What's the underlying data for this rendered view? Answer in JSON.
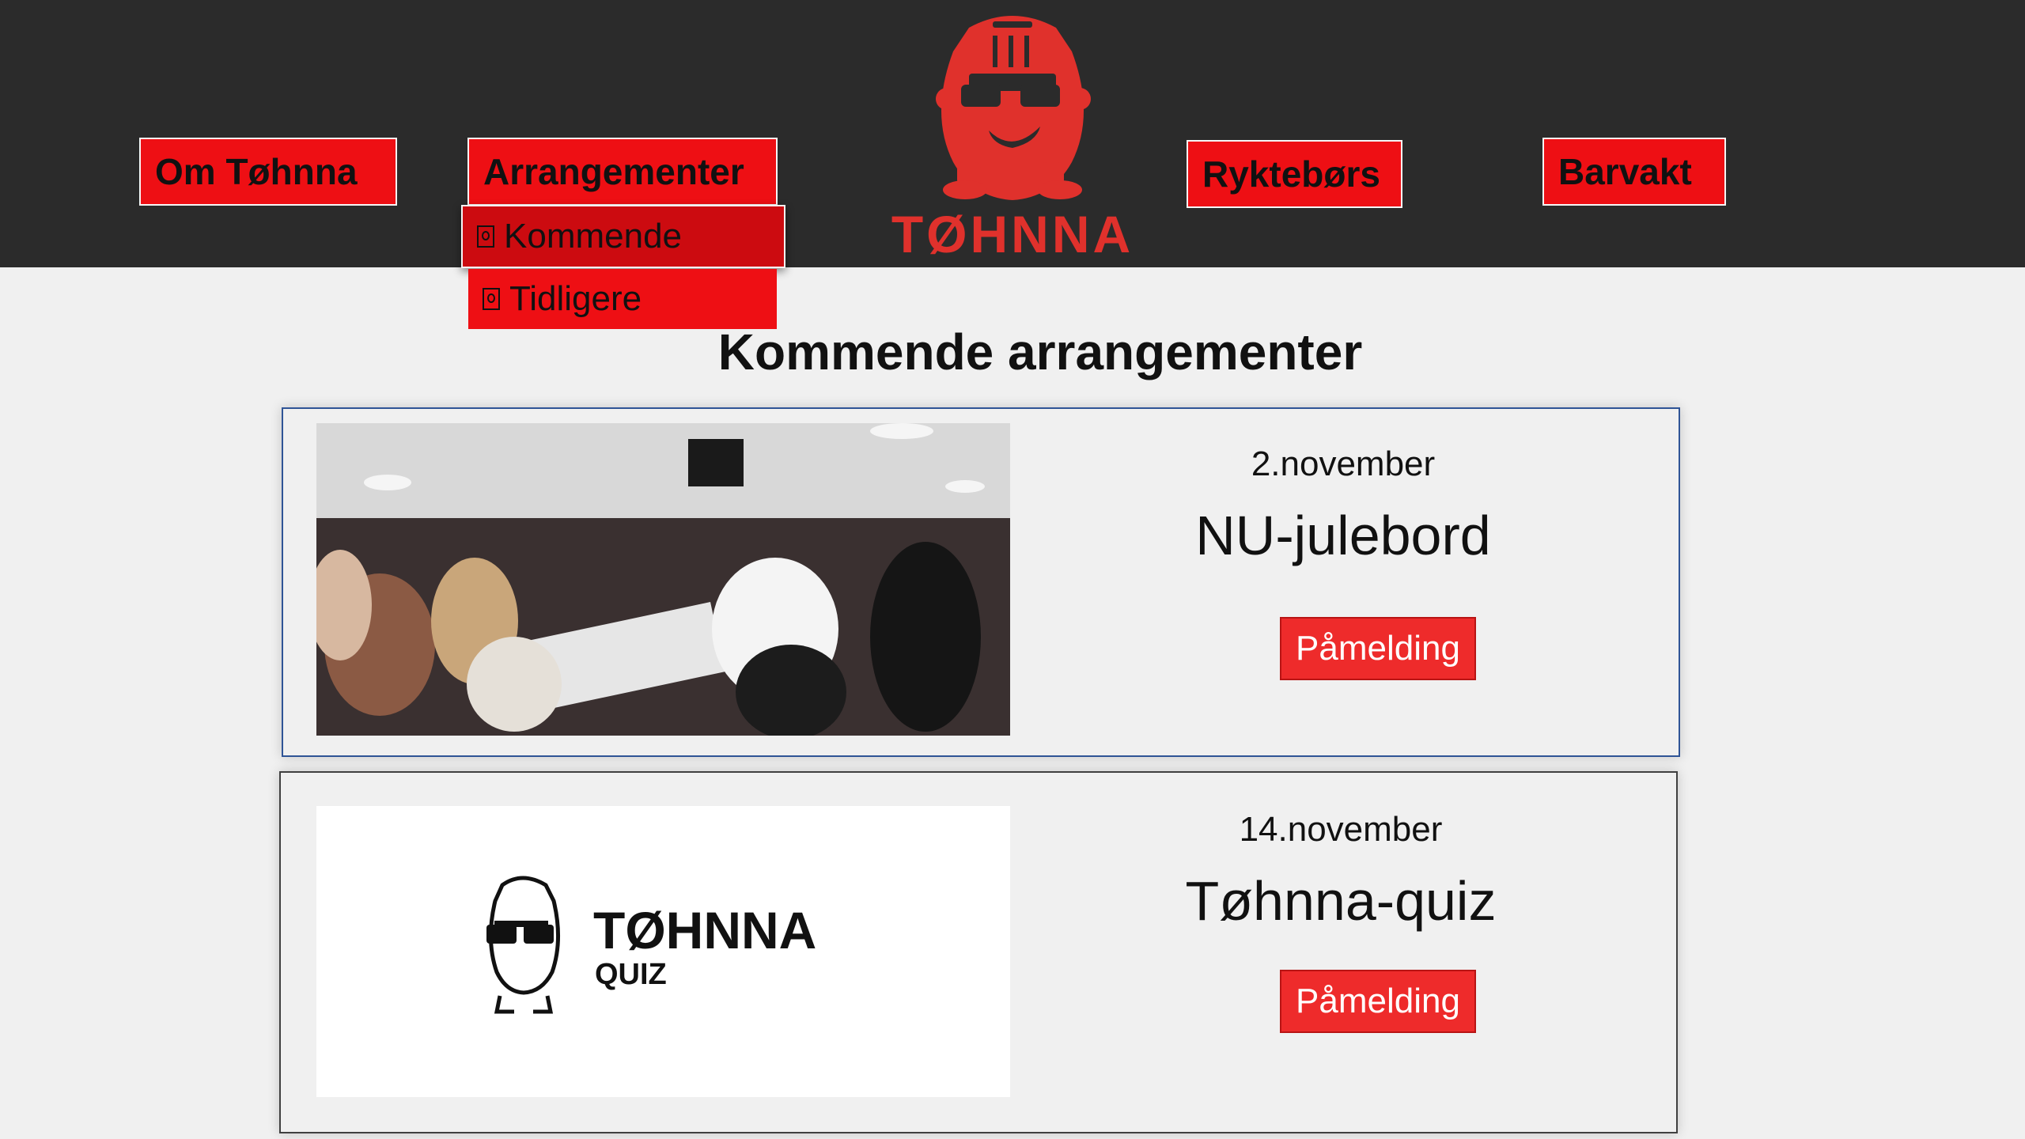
{
  "nav": {
    "about": "Om Tøhnna",
    "events": "Arrangementer",
    "rumors": "Ryktebørs",
    "bar": "Barvakt"
  },
  "dropdown": {
    "upcoming": "Kommende",
    "previous": "Tidligere"
  },
  "logo": {
    "text": "TØHNNA"
  },
  "page": {
    "heading": "Kommende arrangementer"
  },
  "events": [
    {
      "date": "2.november",
      "title": "NU-julebord",
      "signup": "Påmelding"
    },
    {
      "date": "14.november",
      "title": "Tøhnna-quiz",
      "signup": "Påmelding"
    }
  ],
  "quiz_logo": {
    "title": "TØHNNA",
    "subtitle": "QUIZ"
  },
  "colors": {
    "accent": "#ee0f14",
    "header_bg": "#2b2b2b",
    "logo_red": "#e0312c"
  }
}
